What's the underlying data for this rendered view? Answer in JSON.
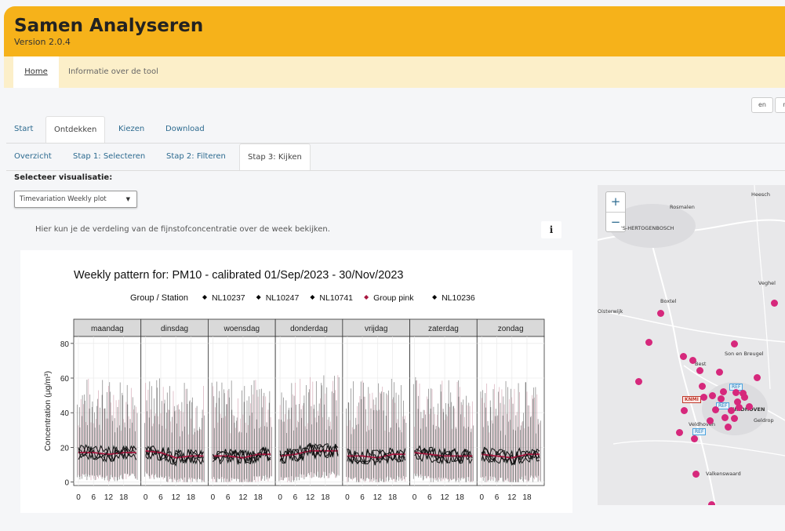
{
  "app": {
    "title": "Samen Analyseren",
    "version": "Version 2.0.4"
  },
  "nav": {
    "home": "Home",
    "info": "Informatie over de tool"
  },
  "languages": [
    "en",
    "nl"
  ],
  "main_tabs": [
    {
      "label": "Start",
      "active": false
    },
    {
      "label": "Ontdekken",
      "active": true
    },
    {
      "label": "Kiezen",
      "active": false
    },
    {
      "label": "Download",
      "active": false
    }
  ],
  "sub_tabs": [
    {
      "label": "Overzicht",
      "active": false
    },
    {
      "label": "Stap 1: Selecteren",
      "active": false
    },
    {
      "label": "Stap 2: Filteren",
      "active": false
    },
    {
      "label": "Stap 3: Kijken",
      "active": true
    }
  ],
  "visualisation": {
    "label": "Selecteer visualisatie:",
    "selected": "Timevariation Weekly plot",
    "description": "Hier kun je de verdeling van de fijnstofconcentratie over de week bekijken.",
    "info_button": "i"
  },
  "chart_data": {
    "type": "line",
    "title": "Weekly pattern for: PM10 - calibrated  01/Sep/2023 - 30/Nov/2023",
    "legend_title": "Group / Station",
    "series": [
      {
        "name": "NL10237",
        "color": "#000000"
      },
      {
        "name": "NL10247",
        "color": "#000000"
      },
      {
        "name": "NL10741",
        "color": "#000000"
      },
      {
        "name": "Group pink",
        "color": "#a8173f"
      },
      {
        "name": "NL10236",
        "color": "#000000"
      }
    ],
    "panels": [
      "maandag",
      "dinsdag",
      "woensdag",
      "donderdag",
      "vrijdag",
      "zaterdag",
      "zondag"
    ],
    "x_ticks": [
      "0",
      "6",
      "12",
      "18"
    ],
    "ylabel": "Concentration (μg/m³)",
    "y_ticks": [
      "0",
      "20",
      "40",
      "60",
      "80"
    ],
    "ylim": [
      -2,
      84
    ],
    "hours": [
      0,
      6,
      12,
      18
    ],
    "group_pink_approx": [
      [
        17,
        17,
        16,
        17
      ],
      [
        18,
        17,
        14,
        15
      ],
      [
        15,
        15,
        14,
        16
      ],
      [
        15,
        16,
        18,
        18
      ],
      [
        15,
        15,
        14,
        16
      ],
      [
        17,
        16,
        15,
        15
      ],
      [
        16,
        15,
        14,
        16
      ]
    ]
  },
  "map": {
    "zoom_in": "+",
    "zoom_out": "−",
    "labels": [
      "Heesch",
      "Rosmalen",
      "'S-HERTOGENBOSCH",
      "Veghel",
      "Boxtel",
      "Oisterwijk",
      "Son en Breugel",
      "Best",
      "Veldhoven",
      "Geldrop",
      "Valkenswaard",
      "EINDHOVEN"
    ],
    "ref_label": "REF",
    "knmi_label": "KNMI",
    "marker_color": "#d6287c"
  }
}
